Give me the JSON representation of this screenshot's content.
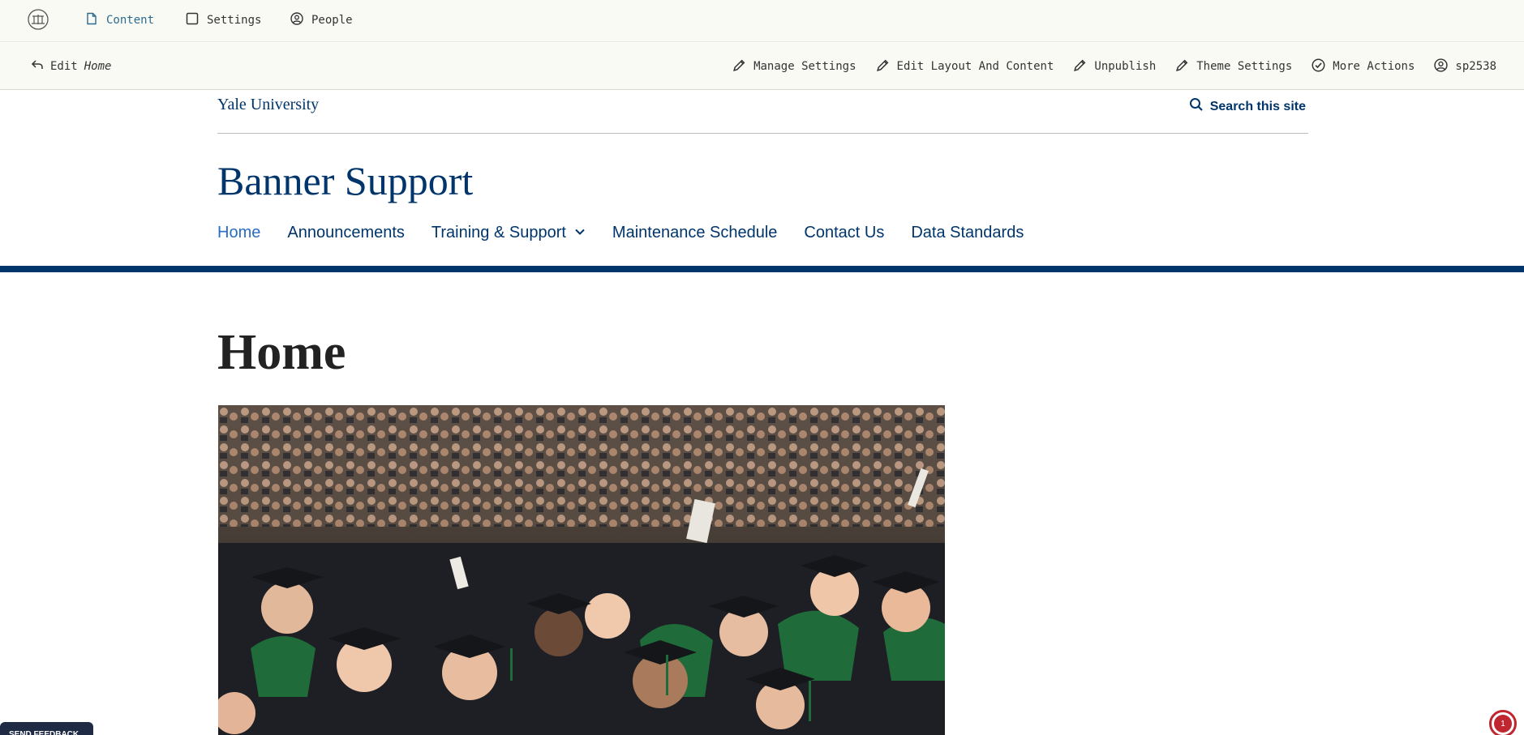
{
  "admin": {
    "logo_icon": "yalesites-logo-icon",
    "tabs": [
      {
        "label": "Content",
        "icon": "document-icon",
        "active": true
      },
      {
        "label": "Settings",
        "icon": "square-icon",
        "active": false
      },
      {
        "label": "People",
        "icon": "user-circle-icon",
        "active": false
      }
    ],
    "back_prefix": "Edit",
    "back_page": "Home",
    "actions": [
      {
        "label": "Manage Settings",
        "icon": "pencil-icon"
      },
      {
        "label": "Edit Layout And Content",
        "icon": "pencil-icon"
      },
      {
        "label": "Unpublish",
        "icon": "pencil-icon"
      },
      {
        "label": "Theme Settings",
        "icon": "pencil-icon"
      },
      {
        "label": "More Actions",
        "icon": "check-circle-icon"
      },
      {
        "label": "sp2538",
        "icon": "user-circle-icon"
      }
    ]
  },
  "header": {
    "university": "Yale University",
    "search_label": "Search this site",
    "site_title": "Banner Support"
  },
  "nav": [
    {
      "label": "Home",
      "current": true
    },
    {
      "label": "Announcements"
    },
    {
      "label": "Training & Support",
      "has_dropdown": true
    },
    {
      "label": "Maintenance Schedule"
    },
    {
      "label": "Contact Us"
    },
    {
      "label": "Data Standards"
    }
  ],
  "page": {
    "title": "Home"
  },
  "feedback": {
    "label": "SEND FEEDBACK"
  },
  "notifications": {
    "count": "1"
  },
  "colors": {
    "yale_blue": "#00356b",
    "link_blue": "#286dc0",
    "admin_bg": "#fafaf5",
    "admin_active": "#2b6b8f",
    "badge_red": "#c0262f"
  }
}
